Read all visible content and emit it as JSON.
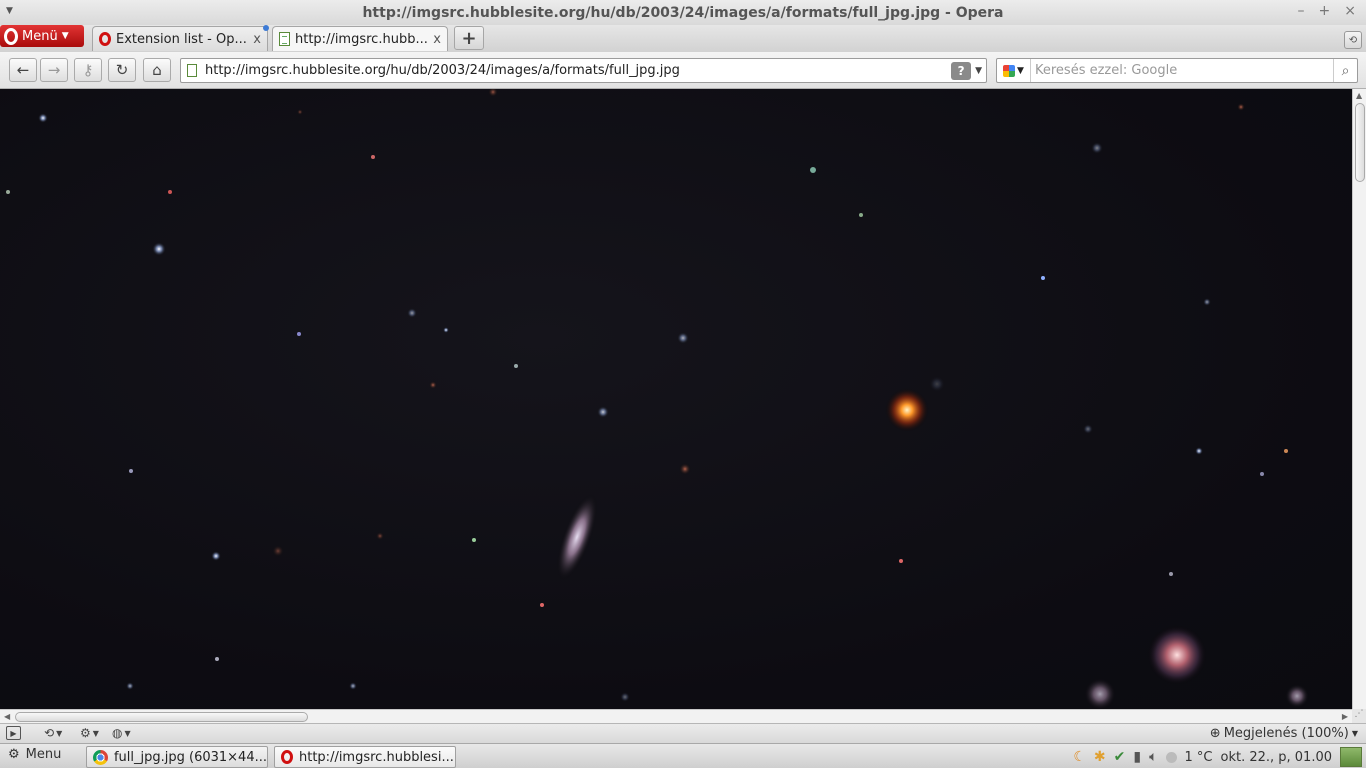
{
  "window": {
    "title": "http://imgsrc.hubblesite.org/hu/db/2003/24/images/a/formats/full_jpg.jpg - Opera",
    "controls": [
      "–",
      "+",
      "×"
    ]
  },
  "menu_button": {
    "label": "Menü"
  },
  "tabs": [
    {
      "label": "Extension list - Op...",
      "close": "x",
      "icon": "opera-icon"
    },
    {
      "label": "http://imgsrc.hubb...",
      "close": "x",
      "icon": "page-icon",
      "active": true
    }
  ],
  "new_tab": {
    "label": "+"
  },
  "navigation": {
    "address": "http://imgsrc.hubblesite.org/hu/db/2003/24/images/a/formats/full_jpg.jpg",
    "help": "?",
    "search_placeholder": "Keresés ezzel: Google",
    "search_engine": "Google"
  },
  "statusbar": {
    "zoom_label": "Megjelenés (100%)"
  },
  "taskbar": {
    "menu_label": "Menu",
    "tasks": [
      {
        "label": "full_jpg.jpg (6031×44...",
        "icon": "chrome-icon"
      },
      {
        "label": "http://imgsrc.hubblesi...",
        "icon": "opera-icon"
      }
    ],
    "temperature": "1 °C",
    "clock": "okt. 22., p, 01.00"
  },
  "colors": {
    "opera_red": "#c81717",
    "space_bg": "#0d0c12",
    "chrome_light": "#ececec"
  }
}
